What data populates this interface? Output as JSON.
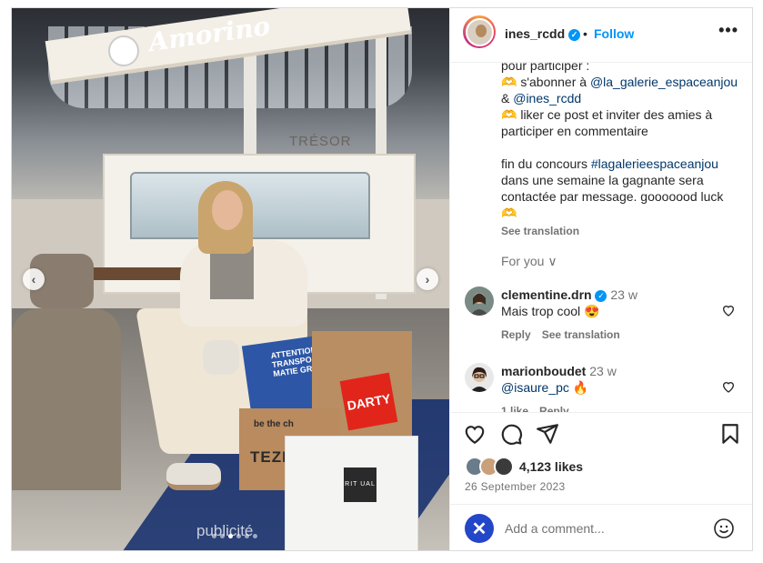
{
  "post": {
    "username": "ines_rcdd",
    "follow_label": "Follow",
    "separator": "•",
    "more_label": "•••",
    "image": {
      "brand_sign": "Amorino",
      "store_sign": "TRÉSOR",
      "publicite": "publicité",
      "bag_blue_text": "ATTENTION TRANSPO DE MATIE GRISE",
      "bag_darty_text": "DARTY",
      "bag_tez_line1": "be the ch",
      "bag_tez_line2": "TEZE",
      "bag_ritual_text": "RIT UAL",
      "prev_label": "‹",
      "next_label": "›"
    }
  },
  "caption": {
    "line1": "pour participer :",
    "line2_emoji": "🫶",
    "line2_text": " s'abonner à ",
    "line2_link": "@la_galerie_espaceanjou",
    "line3_prefix": "& ",
    "line3_link": "@ines_rcdd",
    "line4_emoji": "🫶",
    "line4_text": " liker ce post et inviter des amies à",
    "line5": "participer en commentaire",
    "line6_text": "fin du concours ",
    "line6_link": "#lagalerieespaceanjou",
    "line7": "dans une semaine la gagnante sera",
    "line8": "contactée par message. gooooood luck",
    "line9_emoji": "🫶",
    "see_translation": "See translation",
    "for_you": "For you",
    "for_you_chevron": "∨"
  },
  "comments": [
    {
      "user": "clementine.drn",
      "time": "23 w",
      "text": "Mais trop cool",
      "emoji": "😍",
      "reply": "Reply",
      "see_translation": "See translation"
    },
    {
      "user": "marionboudet",
      "time": "23 w",
      "text": "@isaure_pc",
      "emoji": "🔥",
      "likes": "1 like",
      "reply": "Reply"
    }
  ],
  "footer": {
    "likes": "4,123 likes",
    "date": "26 September 2023",
    "add_comment_placeholder": "Add a comment...",
    "x_icon": "✕"
  },
  "colors": {
    "accent": "#0095f6",
    "link": "#00376b",
    "muted": "#737373"
  }
}
